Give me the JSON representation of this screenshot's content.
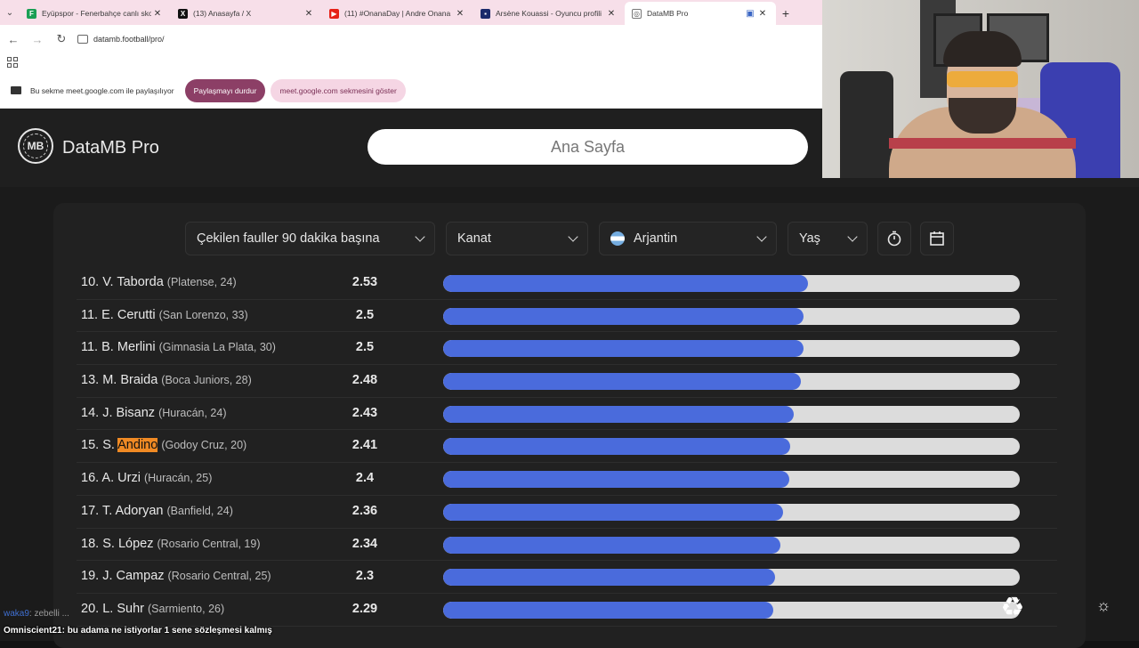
{
  "browser": {
    "tabs": [
      {
        "title": "Eyüpspor - Fenerbahçe canlı skor",
        "icon_color": "#1a9f55"
      },
      {
        "title": "(13) Anasayfa / X",
        "icon_color": "#111111"
      },
      {
        "title": "(11) #OnanaDay | Andre Onana",
        "icon_color": "#e62117"
      },
      {
        "title": "Arsène Kouassi - Oyuncu profili",
        "icon_color": "#1b2a6b"
      },
      {
        "title": "DataMB Pro",
        "icon_color": "#ffffff"
      }
    ],
    "url": "datamb.football/pro/"
  },
  "sharebar": {
    "text": "Bu sekme meet.google.com ile paylaşılıyor",
    "stop_label": "Paylaşmayı durdur",
    "show_label": "meet.google.com sekmesini göster"
  },
  "app": {
    "logo_text": "MB",
    "brand": "DataMB Pro",
    "nav_label": "Ana Sayfa"
  },
  "filters": {
    "metric": "Çekilen fauller 90 dakika başına",
    "position": "Kanat",
    "country": "Arjantin",
    "age": "Yaş"
  },
  "scale_max": 4.0,
  "rows": [
    {
      "rank": "10.",
      "initial": "V.",
      "surname": "Taborda",
      "club": "(Platense, 24)",
      "value": "2.53",
      "num": 2.53
    },
    {
      "rank": "11.",
      "initial": "E.",
      "surname": "Cerutti",
      "club": "(San Lorenzo, 33)",
      "value": "2.5",
      "num": 2.5
    },
    {
      "rank": "11.",
      "initial": "B.",
      "surname": "Merlini",
      "club": "(Gimnasia La Plata, 30)",
      "value": "2.5",
      "num": 2.5
    },
    {
      "rank": "13.",
      "initial": "M.",
      "surname": "Braida",
      "club": "(Boca Juniors, 28)",
      "value": "2.48",
      "num": 2.48
    },
    {
      "rank": "14.",
      "initial": "J.",
      "surname": "Bisanz",
      "club": "(Huracán, 24)",
      "value": "2.43",
      "num": 2.43
    },
    {
      "rank": "15.",
      "initial": "S.",
      "surname": "Andino",
      "club": "(Godoy Cruz, 20)",
      "value": "2.41",
      "num": 2.41,
      "highlight": true
    },
    {
      "rank": "16.",
      "initial": "A.",
      "surname": "Urzi",
      "club": "(Huracán, 25)",
      "value": "2.4",
      "num": 2.4
    },
    {
      "rank": "17.",
      "initial": "T.",
      "surname": "Adoryan",
      "club": "(Banfield, 24)",
      "value": "2.36",
      "num": 2.36
    },
    {
      "rank": "18.",
      "initial": "S.",
      "surname": "López",
      "club": "(Rosario Central, 19)",
      "value": "2.34",
      "num": 2.34
    },
    {
      "rank": "19.",
      "initial": "J.",
      "surname": "Campaz",
      "club": "(Rosario Central, 25)",
      "value": "2.3",
      "num": 2.3
    },
    {
      "rank": "20.",
      "initial": "L.",
      "surname": "Suhr",
      "club": "(Sarmiento, 26)",
      "value": "2.29",
      "num": 2.29
    }
  ],
  "chat": [
    {
      "user": "waka9",
      "message": ": zebelli ... "
    },
    {
      "user": "Omniscient21",
      "message": ": bu adama ne istiyorlar 1 sene sözleşmesi kalmış"
    }
  ]
}
